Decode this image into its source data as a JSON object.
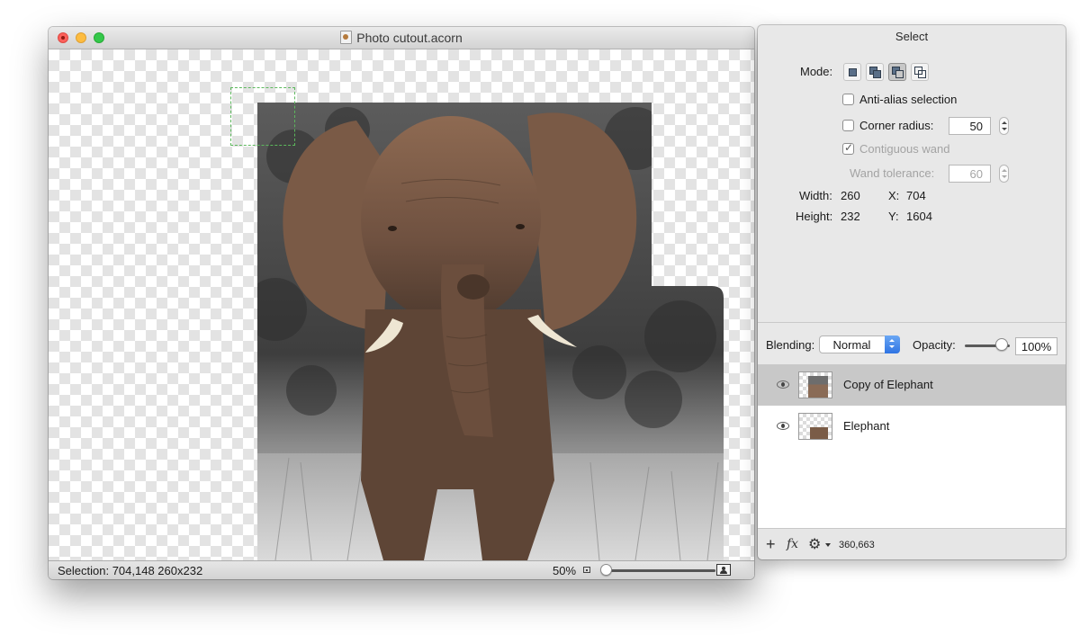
{
  "document_window": {
    "title": "Photo cutout.acorn",
    "status": {
      "selection_text": "Selection: 704,148 260x232",
      "zoom_label": "50%",
      "zoom_fraction": 0.02
    }
  },
  "select_panel": {
    "title": "Select",
    "mode_label": "Mode:",
    "mode_buttons": [
      "new-selection",
      "add-to-selection",
      "subtract-from-selection",
      "intersect-selection"
    ],
    "selected_mode_index": 2,
    "anti_alias": {
      "label": "Anti-alias selection",
      "checked": false
    },
    "corner_radius": {
      "label": "Corner radius:",
      "checked": false,
      "value": "50"
    },
    "contiguous_wand": {
      "label": "Contiguous wand",
      "checked": true,
      "enabled": false
    },
    "wand_tolerance": {
      "label": "Wand tolerance:",
      "value": "60",
      "enabled": false
    },
    "width_label": "Width:",
    "width_value": "260",
    "height_label": "Height:",
    "height_value": "232",
    "x_label": "X:",
    "x_value": "704",
    "y_label": "Y:",
    "y_value": "1604"
  },
  "layers_panel": {
    "blending_label": "Blending:",
    "blending_value": "Normal",
    "opacity_label": "Opacity:",
    "opacity_value": "100%",
    "opacity_fraction": 1.0,
    "layers": [
      {
        "name": "Copy of Elephant",
        "visible": true,
        "selected": true
      },
      {
        "name": "Elephant",
        "visible": true,
        "selected": false
      }
    ],
    "footer": {
      "add_icon": "plus-icon",
      "effects_label": "fx",
      "settings_icon": "gear-icon",
      "coords": "360,663"
    }
  }
}
